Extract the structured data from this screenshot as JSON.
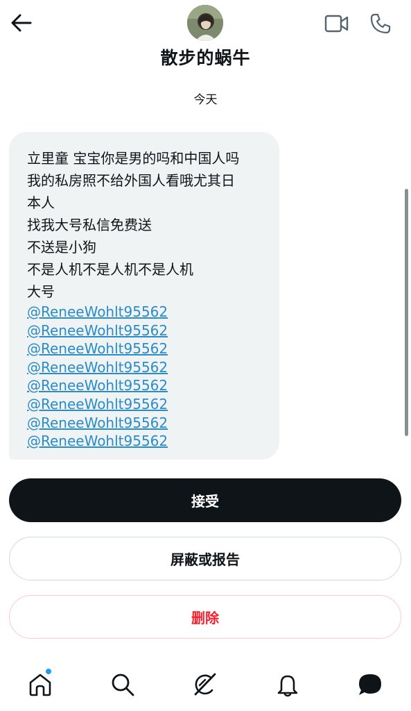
{
  "header": {
    "title": "散步的蜗牛",
    "back_icon": "arrow-left-icon",
    "video_icon": "video-camera-icon",
    "call_icon": "phone-icon"
  },
  "date_divider": "今天",
  "message": {
    "lines": [
      "立里童 宝宝你是男的吗和中国人吗",
      "我的私房照不给外国人看哦尤其日",
      "本人",
      "找我大号私信免费送",
      "不送是小狗",
      "不是人机不是人机不是人机",
      "大号"
    ],
    "mentions": [
      "@ReneeWohlt95562",
      "@ReneeWohlt95562",
      "@ReneeWohlt95562",
      "@ReneeWohlt95562",
      "@ReneeWohlt95562",
      "@ReneeWohlt95562",
      "@ReneeWohlt95562",
      "@ReneeWohlt95562"
    ]
  },
  "actions": {
    "accept_label": "接受",
    "block_report_label": "屏蔽或报告",
    "delete_label": "删除"
  },
  "bottom_nav": {
    "items": [
      {
        "name": "home",
        "icon": "home-icon",
        "has_badge": true
      },
      {
        "name": "search",
        "icon": "search-icon",
        "has_badge": false
      },
      {
        "name": "grok",
        "icon": "grok-icon",
        "has_badge": false
      },
      {
        "name": "notifications",
        "icon": "bell-icon",
        "has_badge": false
      },
      {
        "name": "messages",
        "icon": "message-icon",
        "has_badge": false
      }
    ]
  },
  "colors": {
    "accent": "#1d9bf0",
    "mention_link": "#2a8cc8",
    "delete": "#f4212e",
    "bubble": "#eff3f4",
    "primary_button": "#0f1419"
  }
}
